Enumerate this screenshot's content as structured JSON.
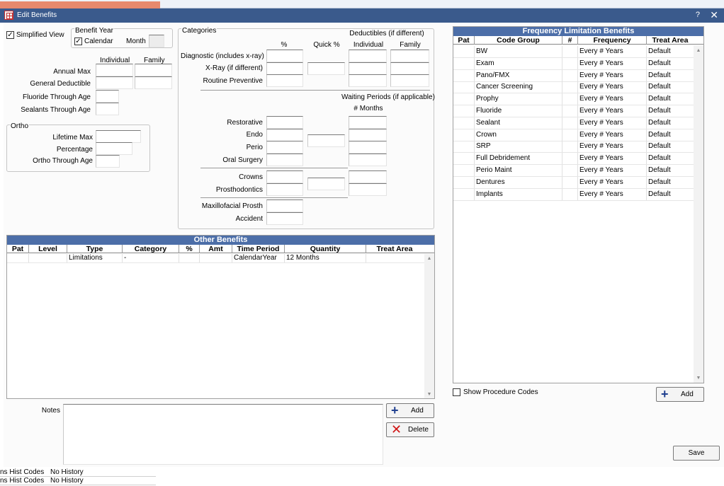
{
  "background": {
    "left_codes": [
      {
        "label": "ns Hist Codes",
        "value": "No History"
      },
      {
        "label": "ns Hist Codes",
        "value": "No History"
      }
    ]
  },
  "window": {
    "title": "Edit Benefits",
    "help": "?",
    "close": "✕"
  },
  "simplified_view": {
    "label": "Simplified View",
    "checked": true
  },
  "benefit_year": {
    "title": "Benefit Year",
    "calendar_label": "Calendar",
    "calendar_checked": true,
    "month_label": "Month"
  },
  "ind_fam": {
    "individual_header": "Individual",
    "family_header": "Family",
    "annual_max": "Annual Max",
    "general_deductible": "General Deductible",
    "fluoride_age": "Fluoride Through Age",
    "sealants_age": "Sealants Through Age"
  },
  "ortho": {
    "title": "Ortho",
    "lifetime_max": "Lifetime Max",
    "percentage": "Percentage",
    "through_age": "Ortho Through Age"
  },
  "categories": {
    "title": "Categories",
    "deductibles_header": "Deductibles (if different)",
    "pct_header": "%",
    "quick_header": "Quick %",
    "individual_header": "Individual",
    "family_header": "Family",
    "waiting_header": "Waiting Periods (if applicable)",
    "months_header": "# Months",
    "rows": {
      "diagnostic": "Diagnostic (includes x-ray)",
      "xray": "X-Ray (if different)",
      "routine": "Routine Preventive",
      "restorative": "Restorative",
      "endo": "Endo",
      "perio": "Perio",
      "oral_surgery": "Oral Surgery",
      "crowns": "Crowns",
      "prosth": "Prosthodontics",
      "maxillofacial": "Maxillofacial Prosth",
      "accident": "Accident"
    }
  },
  "other_benefits": {
    "title": "Other Benefits",
    "columns": [
      "Pat",
      "Level",
      "Type",
      "Category",
      "%",
      "Amt",
      "Time Period",
      "Quantity",
      "Treat Area"
    ],
    "rows": [
      [
        "",
        "",
        "Limitations",
        "-",
        "",
        "",
        "CalendarYear",
        "12 Months",
        ""
      ]
    ]
  },
  "notes": {
    "label": "Notes",
    "value": ""
  },
  "buttons": {
    "add": "Add",
    "delete": "Delete",
    "add_freq": "Add",
    "save": "Save"
  },
  "frequency": {
    "title": "Frequency Limitation Benefits",
    "columns": [
      "Pat",
      "Code Group",
      "#",
      "Frequency",
      "Treat Area"
    ],
    "rows": [
      [
        "",
        "BW",
        "",
        "Every # Years",
        "Default"
      ],
      [
        "",
        "Exam",
        "",
        "Every # Years",
        "Default"
      ],
      [
        "",
        "Pano/FMX",
        "",
        "Every # Years",
        "Default"
      ],
      [
        "",
        "Cancer Screening",
        "",
        "Every # Years",
        "Default"
      ],
      [
        "",
        "Prophy",
        "",
        "Every # Years",
        "Default"
      ],
      [
        "",
        "Fluoride",
        "",
        "Every # Years",
        "Default"
      ],
      [
        "",
        "Sealant",
        "",
        "Every # Years",
        "Default"
      ],
      [
        "",
        "Crown",
        "",
        "Every # Years",
        "Default"
      ],
      [
        "",
        "SRP",
        "",
        "Every # Years",
        "Default"
      ],
      [
        "",
        "Full Debridement",
        "",
        "Every # Years",
        "Default"
      ],
      [
        "",
        "Perio Maint",
        "",
        "Every # Years",
        "Default"
      ],
      [
        "",
        "Dentures",
        "",
        "Every # Years",
        "Default"
      ],
      [
        "",
        "Implants",
        "",
        "Every # Years",
        "Default"
      ]
    ],
    "show_codes_label": "Show Procedure Codes",
    "show_codes_checked": false
  },
  "colors": {
    "title_bar": "#3a5a8c",
    "grid_header": "#4c6ea8",
    "add_icon": "#1f3f8f",
    "delete_icon": "#d01414"
  }
}
